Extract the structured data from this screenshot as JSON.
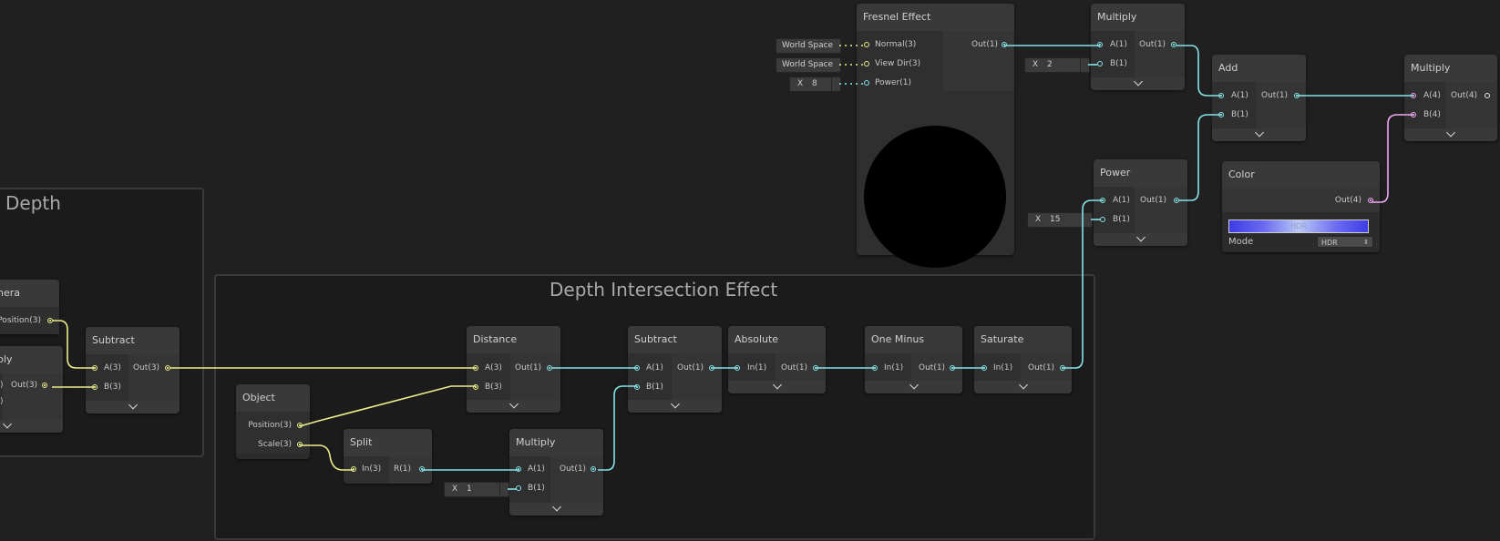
{
  "groups": {
    "screen_depth": {
      "title": "n Depth"
    },
    "depth_intersection": {
      "title": "Depth Intersection Effect"
    }
  },
  "nodes": {
    "camera": {
      "title": "nera",
      "ports": {
        "position_out": "Position(3)"
      }
    },
    "multiply_left": {
      "title": "ply",
      "ports": {
        "in_a": ")",
        "out": "Out(3)",
        "in_b": ")"
      }
    },
    "subtract_left": {
      "title": "Subtract",
      "ports": {
        "a": "A(3)",
        "b": "B(3)",
        "out": "Out(3)"
      }
    },
    "object": {
      "title": "Object",
      "ports": {
        "position": "Position(3)",
        "scale": "Scale(3)"
      }
    },
    "split": {
      "title": "Split",
      "ports": {
        "in": "In(3)",
        "r": "R(1)"
      }
    },
    "distance": {
      "title": "Distance",
      "ports": {
        "a": "A(3)",
        "b": "B(3)",
        "out": "Out(1)"
      }
    },
    "multiply_mid": {
      "title": "Multiply",
      "ports": {
        "a": "A(1)",
        "b": "B(1)",
        "out": "Out(1)"
      }
    },
    "subtract_mid": {
      "title": "Subtract",
      "ports": {
        "a": "A(1)",
        "b": "B(1)",
        "out": "Out(1)"
      }
    },
    "absolute": {
      "title": "Absolute",
      "ports": {
        "in": "In(1)",
        "out": "Out(1)"
      }
    },
    "one_minus": {
      "title": "One Minus",
      "ports": {
        "in": "In(1)",
        "out": "Out(1)"
      }
    },
    "saturate": {
      "title": "Saturate",
      "ports": {
        "in": "In(1)",
        "out": "Out(1)"
      }
    },
    "fresnel": {
      "title": "Fresnel Effect",
      "ports": {
        "normal": "Normal(3)",
        "view_dir": "View Dir(3)",
        "power": "Power(1)",
        "out": "Out(1)"
      }
    },
    "multiply_top": {
      "title": "Multiply",
      "ports": {
        "a": "A(1)",
        "b": "B(1)",
        "out": "Out(1)"
      }
    },
    "add": {
      "title": "Add",
      "ports": {
        "a": "A(1)",
        "b": "B(1)",
        "out": "Out(1)"
      }
    },
    "power": {
      "title": "Power",
      "ports": {
        "a": "A(1)",
        "b": "B(1)",
        "out": "Out(1)"
      }
    },
    "color": {
      "title": "Color",
      "ports": {
        "out": "Out(4)"
      },
      "hdr_label": "HDR",
      "mode_label": "Mode",
      "mode_value": "HDR",
      "swatch_color": "#6a6af2"
    },
    "multiply_right": {
      "title": "Multiply",
      "ports": {
        "a": "A(4)",
        "b": "B(4)",
        "out": "Out(4)"
      }
    }
  },
  "inline_inputs": {
    "fresnel_normal": "World Space",
    "fresnel_viewdir": "World Space",
    "fresnel_power": {
      "axis": "X",
      "value": "8"
    },
    "multiply_top_b": {
      "axis": "X",
      "value": "2"
    },
    "power_b": {
      "axis": "X",
      "value": "15"
    },
    "multiply_mid_b": {
      "axis": "X",
      "value": "1"
    }
  },
  "colors": {
    "vector3_port": "#ecec8a",
    "vector1_port": "#84e4e7",
    "vector4_port": "#f0a8f0",
    "canvas_bg": "#202020"
  }
}
